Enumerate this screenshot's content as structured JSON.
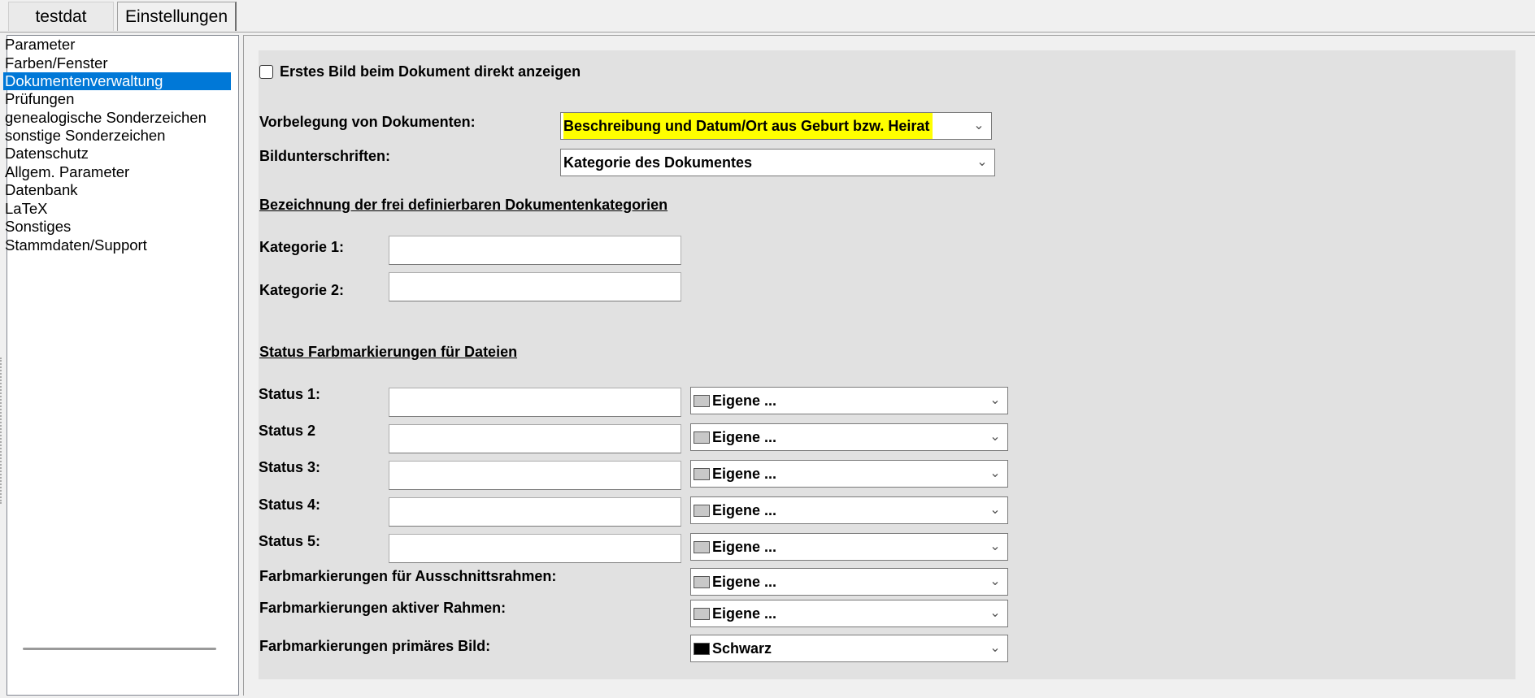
{
  "tabs": [
    {
      "label": "testdat"
    },
    {
      "label": "Einstellungen"
    }
  ],
  "sidebar": {
    "items": [
      {
        "label": "Parameter"
      },
      {
        "label": "Farben/Fenster"
      },
      {
        "label": "Dokumentenverwaltung",
        "selected": true
      },
      {
        "label": "Prüfungen"
      },
      {
        "label": "genealogische Sonderzeichen"
      },
      {
        "label": "sonstige Sonderzeichen"
      },
      {
        "label": "Datenschutz"
      },
      {
        "label": "Allgem. Parameter"
      },
      {
        "label": "Datenbank"
      },
      {
        "label": "LaTeX"
      },
      {
        "label": "Sonstiges"
      },
      {
        "label": "Stammdaten/Support"
      }
    ]
  },
  "settings": {
    "first_image_checkbox": {
      "label": "Erstes Bild beim Dokument direkt anzeigen",
      "checked": false
    },
    "prefill": {
      "label": "Vorbelegung von Dokumenten:",
      "value": "Beschreibung und Datum/Ort aus Geburt bzw. Heirat"
    },
    "captions": {
      "label": "Bildunterschriften:",
      "value": "Kategorie des Dokumentes"
    },
    "categories_heading": "Bezeichnung der frei definierbaren Dokumentenkategorien",
    "categories": [
      {
        "label": "Kategorie 1:",
        "value": ""
      },
      {
        "label": "Kategorie 2:",
        "value": ""
      }
    ],
    "status_heading": "Status Farbmarkierungen für Dateien",
    "status": [
      {
        "label": "Status 1:",
        "value": "",
        "color_label": "Eigene ...",
        "color": "#c8c8c8"
      },
      {
        "label": "Status 2",
        "value": "",
        "color_label": "Eigene ...",
        "color": "#c8c8c8"
      },
      {
        "label": "Status 3:",
        "value": "",
        "color_label": "Eigene ...",
        "color": "#c8c8c8"
      },
      {
        "label": "Status 4:",
        "value": "",
        "color_label": "Eigene ...",
        "color": "#c8c8c8"
      },
      {
        "label": "Status 5:",
        "value": "",
        "color_label": "Eigene ...",
        "color": "#c8c8c8"
      }
    ],
    "crop_frame": {
      "label": "Farbmarkierungen für Ausschnittsrahmen:",
      "color_label": "Eigene ...",
      "color": "#c8c8c8"
    },
    "active_frame": {
      "label": "Farbmarkierungen aktiver Rahmen:",
      "color_label": "Eigene ...",
      "color": "#c8c8c8"
    },
    "primary_image": {
      "label": "Farbmarkierungen primäres Bild:",
      "color_label": "Schwarz",
      "color": "#000000"
    }
  },
  "colors": {
    "selection": "#0078d7",
    "highlight": "#ffff00",
    "panel": "#e1e1e1"
  }
}
